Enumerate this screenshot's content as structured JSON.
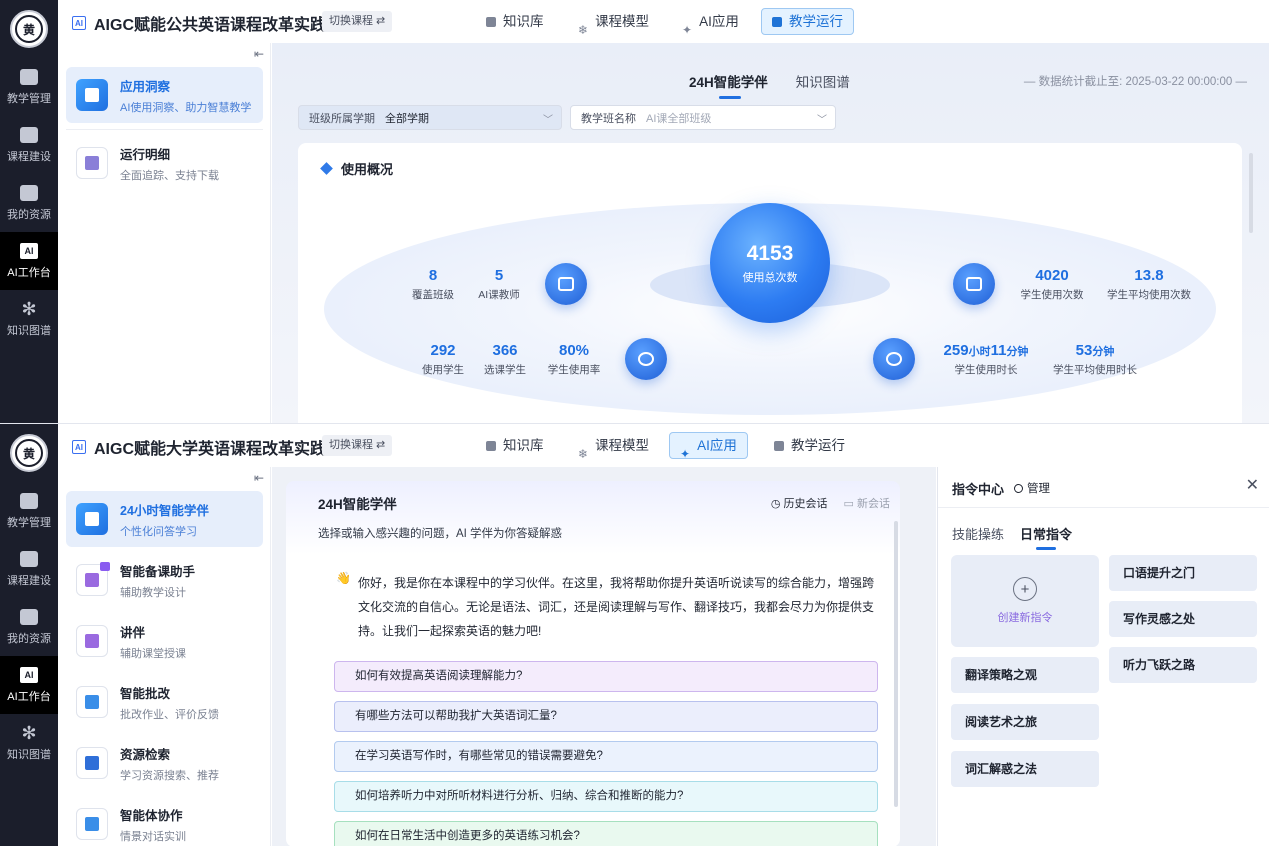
{
  "nav_rail": {
    "logo_text": "黄",
    "items": [
      {
        "label": "教学管理"
      },
      {
        "label": "课程建设"
      },
      {
        "label": "我的资源"
      },
      {
        "label": "AI工作台",
        "badge": "AI"
      },
      {
        "label": "知识图谱"
      }
    ]
  },
  "common": {
    "ai_badge": "AI",
    "switch_course": "切换课程 ⇄",
    "collapse": "⇤",
    "tabs": [
      {
        "label": "知识库"
      },
      {
        "label": "课程模型"
      },
      {
        "label": "AI应用"
      },
      {
        "label": "教学运行"
      }
    ]
  },
  "shot1": {
    "title": "AIGC赋能公共英语课程改革实践",
    "sidebar": [
      {
        "title": "应用洞察",
        "desc": "AI使用洞察、助力智慧教学"
      },
      {
        "title": "运行明细",
        "desc": "全面追踪、支持下载"
      }
    ],
    "subtabs": [
      "24H智能学伴",
      "知识图谱"
    ],
    "stat_date": "— 数据统计截止至:  2025-03-22 00:00:00 —",
    "filters": [
      {
        "label": "班级所属学期",
        "value": "全部学期",
        "chevron": "﹀"
      },
      {
        "label": "教学班名称",
        "placeholder": "AI课全部班级",
        "chevron": "﹀"
      }
    ],
    "overview_title": "使用概况",
    "total": {
      "value": "4153",
      "label": "使用总次数"
    },
    "stats": {
      "classes": {
        "value": "8",
        "label": "覆盖班级"
      },
      "teachers": {
        "value": "5",
        "label": "AI课教师"
      },
      "students_used": {
        "value": "292",
        "label": "使用学生"
      },
      "students_enrolled": {
        "value": "366",
        "label": "选课学生"
      },
      "usage_rate": {
        "value": "80%",
        "label": "学生使用率"
      },
      "student_uses": {
        "value": "4020",
        "label": "学生使用次数"
      },
      "avg_uses": {
        "value": "13.8",
        "label": "学生平均使用次数"
      },
      "usage_time": {
        "hours": "259",
        "hour_unit": "小时",
        "minutes": "11",
        "minute_unit": "分钟",
        "label": "学生使用时长"
      },
      "avg_time": {
        "minutes": "53",
        "minute_unit": "分钟",
        "label": "学生平均使用时长"
      }
    }
  },
  "shot2": {
    "title": "AIGC赋能大学英语课程改革实践",
    "sidebar": [
      {
        "title": "24小时智能学伴",
        "desc": "个性化问答学习"
      },
      {
        "title": "智能备课助手",
        "desc": "辅助教学设计"
      },
      {
        "title": "讲伴",
        "desc": "辅助课堂授课"
      },
      {
        "title": "智能批改",
        "desc": "批改作业、评价反馈"
      },
      {
        "title": "资源检索",
        "desc": "学习资源搜索、推荐"
      },
      {
        "title": "智能体协作",
        "desc": "情景对话实训"
      }
    ],
    "chat": {
      "title": "24H智能学伴",
      "history": "历史会话",
      "new_chat": "新会话",
      "subtitle": "选择或输入感兴趣的问题，AI 学伴为你答疑解惑",
      "wave": "👋",
      "intro": "你好，我是你在本课程中的学习伙伴。在这里，我将帮助你提升英语听说读写的综合能力，增强跨文化交流的自信心。无论是语法、词汇，还是阅读理解与写作、翻译技巧，我都会尽力为你提供支持。让我们一起探索英语的魅力吧!",
      "questions": [
        "如何有效提高英语阅读理解能力?",
        "有哪些方法可以帮助我扩大英语词汇量?",
        "在学习英语写作时，有哪些常见的错误需要避免?",
        "如何培养听力中对所听材料进行分析、归纳、综合和推断的能力?",
        "如何在日常生活中创造更多的英语练习机会?"
      ]
    },
    "panel": {
      "title": "指令中心",
      "manage": "管理",
      "close": "✕",
      "tabs": [
        "技能操练",
        "日常指令"
      ],
      "create_plus": "+",
      "create_label": "创建新指令",
      "commands_left": [
        "翻译策略之观",
        "阅读艺术之旅",
        "词汇解惑之法"
      ],
      "commands_right": [
        "口语提升之门",
        "写作灵感之处",
        "听力飞跃之路"
      ]
    }
  }
}
